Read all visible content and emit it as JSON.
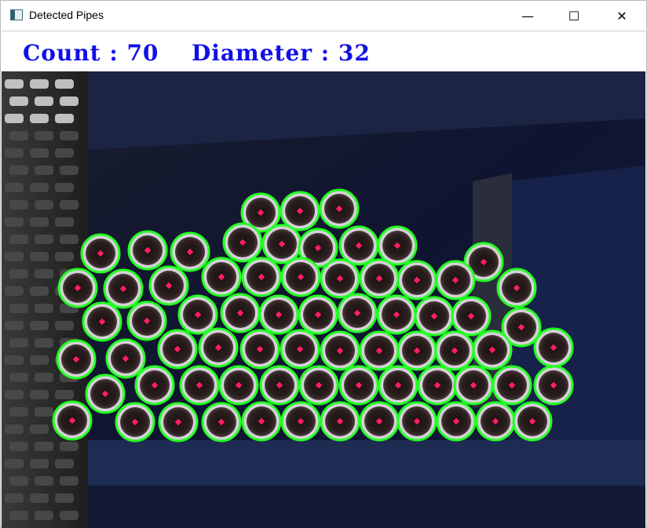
{
  "window": {
    "title": "Detected Pipes",
    "icon": "window-app-icon"
  },
  "controls": {
    "minimize": "—",
    "maximize": "☐",
    "close": "✕"
  },
  "overlay": {
    "count_text": "Count : 70",
    "diameter_text": "Diameter : 32",
    "text_color": "#1010e8"
  },
  "detection": {
    "count": 70,
    "diameter": 32,
    "circle_color": "#22ff22",
    "center_color": "#ff1f5a"
  }
}
